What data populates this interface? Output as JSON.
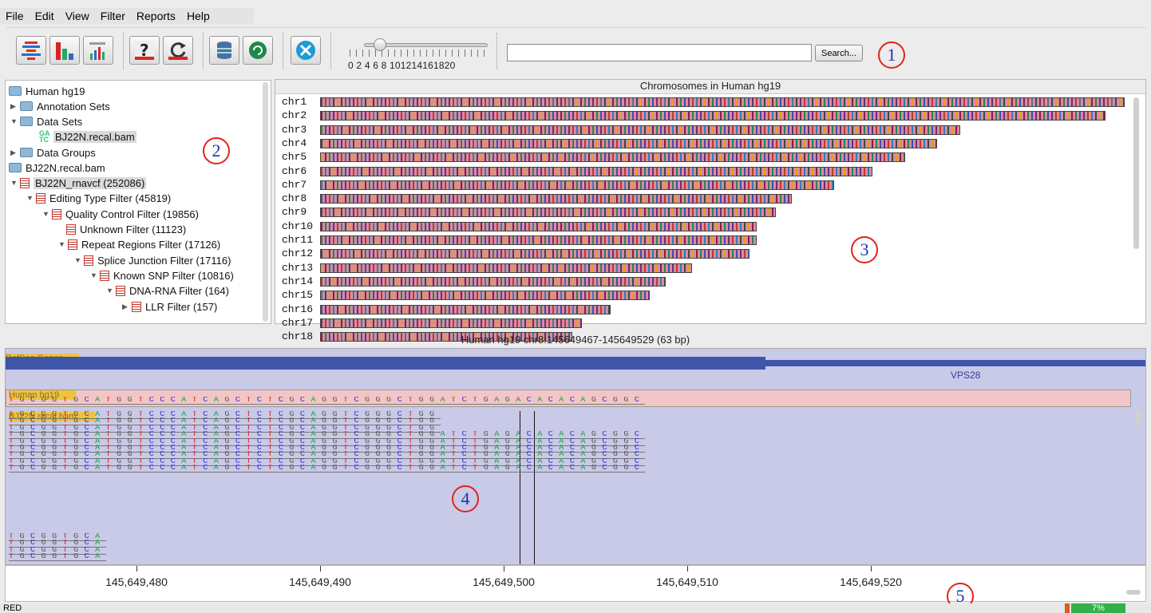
{
  "menu": [
    "File",
    "Edit",
    "View",
    "Filter",
    "Reports",
    "Help"
  ],
  "toolbar": {
    "icons": [
      "genome-view-icon",
      "bar-chart-icon",
      "histogram-icon",
      "help-icon",
      "refresh-icon",
      "database-icon",
      "run-icon",
      "settings-icon"
    ],
    "slider_labels": "0 2 4 6 8 101214161820",
    "slider_value": 2,
    "search_value": "",
    "search_label": "Search..."
  },
  "callouts": [
    "1",
    "2",
    "3",
    "4",
    "5"
  ],
  "tree": {
    "genome": "Human hg19",
    "annotation_sets": "Annotation Sets",
    "data_sets": "Data Sets",
    "bam_file": "BJ22N.recal.bam",
    "data_groups": "Data Groups",
    "bam_group": "BJ22N.recal.bam",
    "filters": [
      "BJ22N_rnavcf (252086)",
      "Editing Type Filter (45819)",
      "Quality Control Filter (19856)",
      "Unknown Filter (11123)",
      "Repeat Regions Filter (17126)",
      "Splice Junction Filter (17116)",
      "Known SNP Filter (10816)",
      "DNA-RNA Filter (164)",
      "LLR Filter (157)"
    ]
  },
  "chromosomes": {
    "title": "Chromosomes in Human hg19",
    "list": [
      "chr1",
      "chr2",
      "chr3",
      "chr4",
      "chr5",
      "chr6",
      "chr7",
      "chr8",
      "chr9",
      "chr10",
      "chr11",
      "chr12",
      "chr13",
      "chr14",
      "chr15",
      "chr16",
      "chr17",
      "chr18"
    ],
    "lengths_mb": [
      249,
      243,
      198,
      191,
      181,
      171,
      159,
      146,
      141,
      135,
      135,
      133,
      115,
      107,
      102,
      90,
      81,
      78
    ]
  },
  "location": {
    "title": "Human hg19 chr8:145649467-145649529 (63 bp)",
    "tracks": {
      "genes": "RefSeq Genes",
      "gene_name": "VPS28",
      "reference": "Human hg19",
      "bam": "BJ22N.recal.bam"
    },
    "sequence": "TGCGGTGCATGGTCCCATCAGCTCTCGCAGGTCGGGCTGGATCTGAGACACACAGCGGC",
    "axis_labels": [
      "145,649,480",
      "145,649,490",
      "145,649,500",
      "145,649,510",
      "145,649,520"
    ]
  },
  "status": {
    "mode": "RED",
    "progress_label": "7%",
    "progress": 0.07
  },
  "colors": {
    "A": "#1fa34a",
    "C": "#2b2bd6",
    "G": "#555555",
    "T": "#d62020",
    "track_bg": "#c9c9e8",
    "gene_bar": "#3f55a8",
    "ref_track": "#f2c6c6",
    "progress": "#33b04a"
  }
}
